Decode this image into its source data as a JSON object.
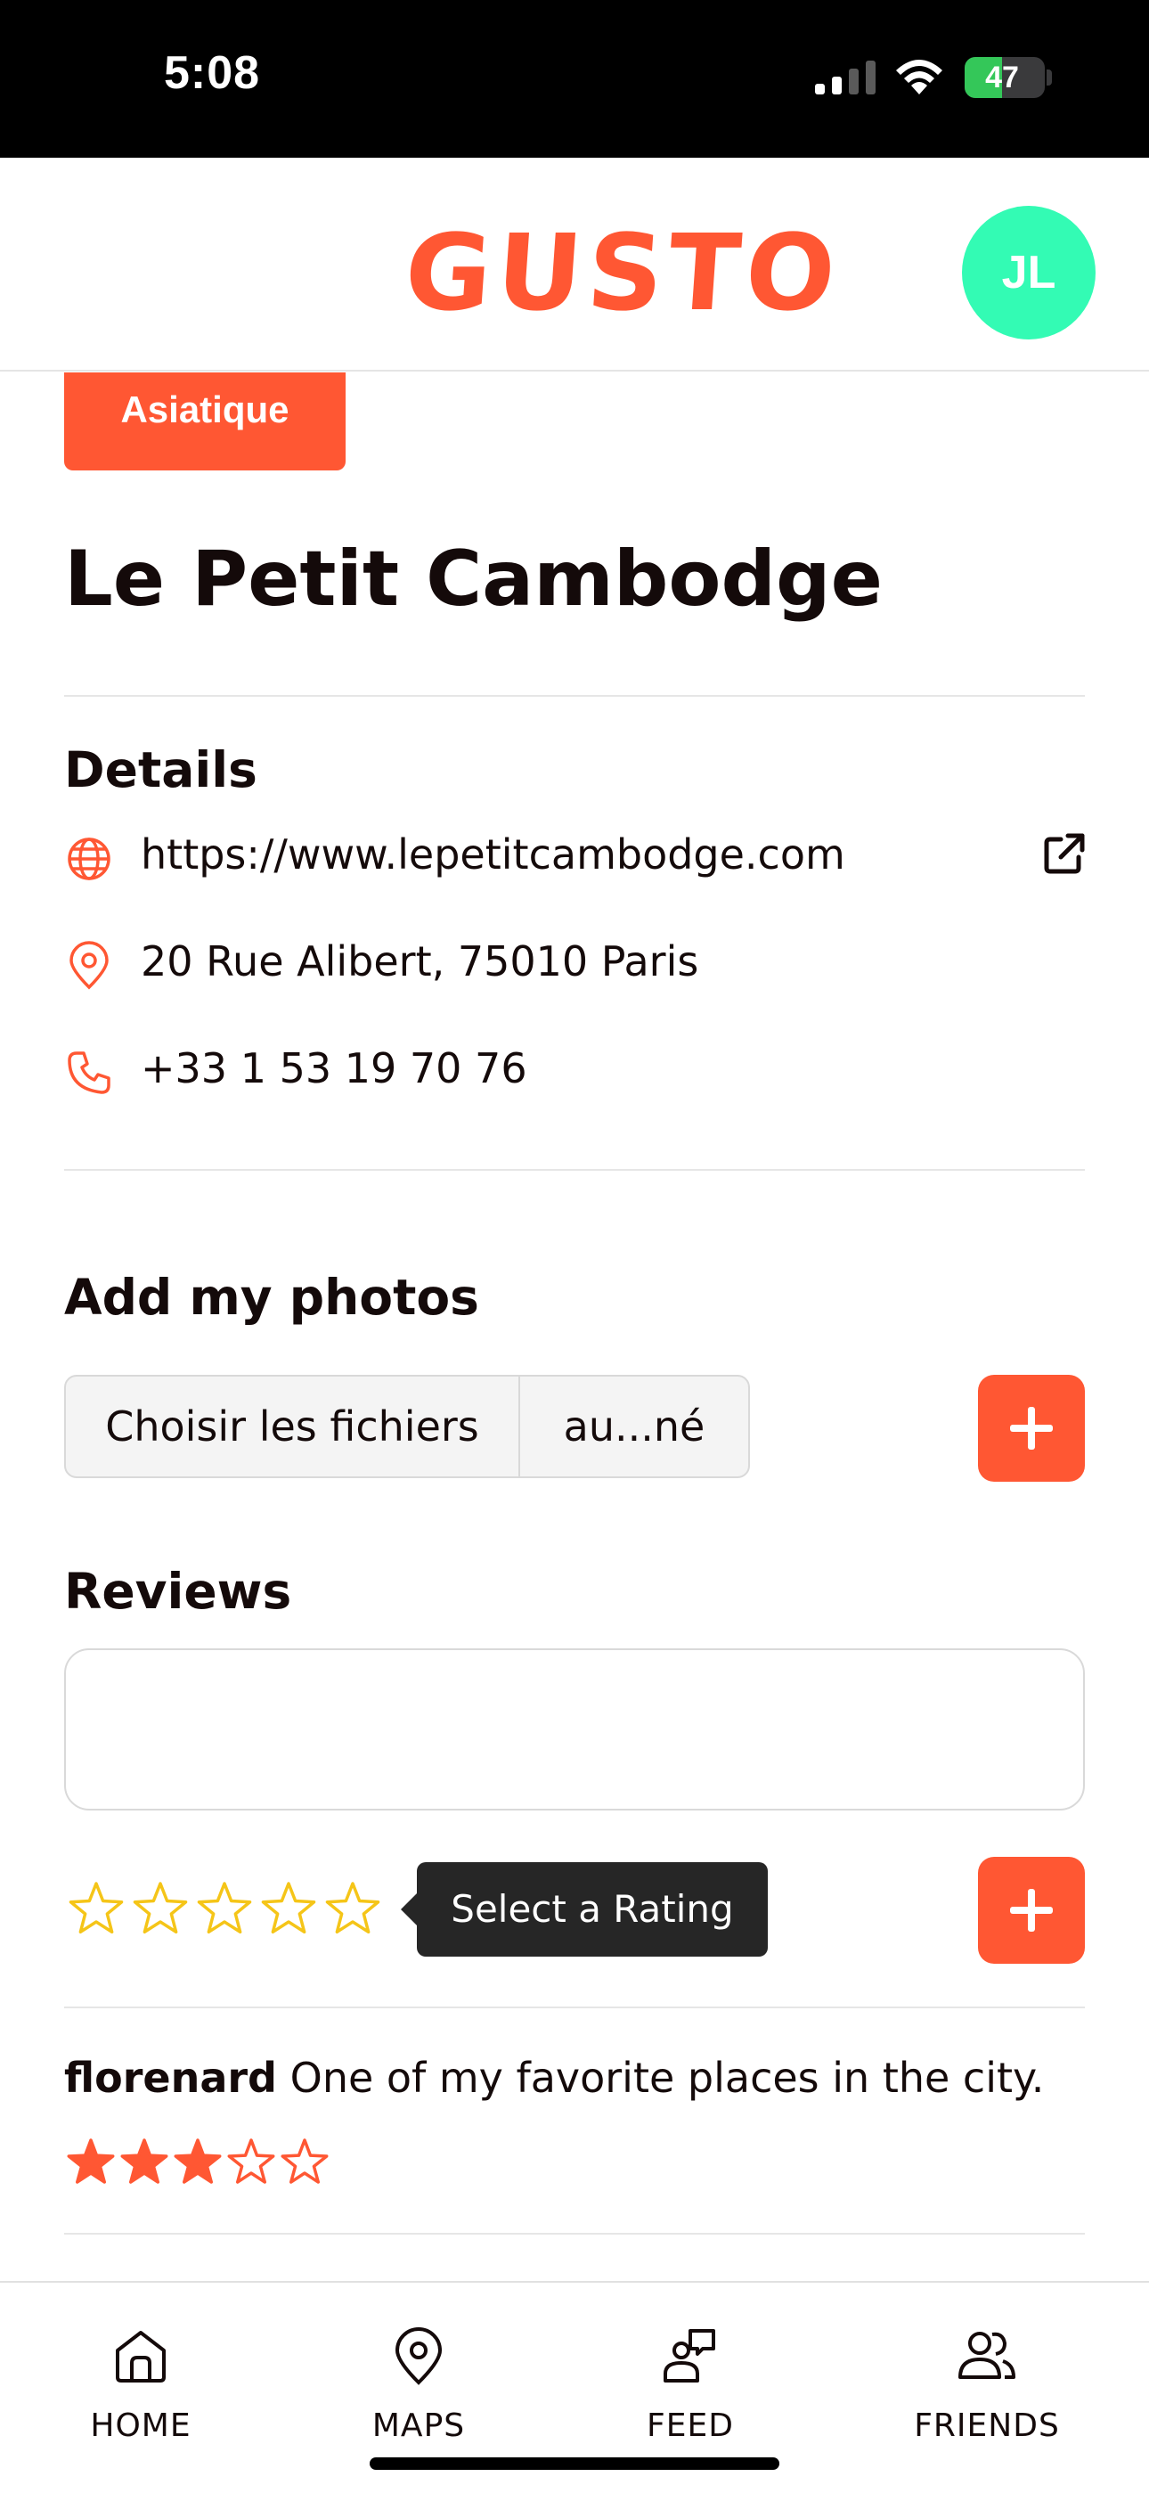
{
  "status_bar": {
    "time": "5:08",
    "battery": "47",
    "battery_level": 0.47
  },
  "header": {
    "logo": "GUSTO",
    "avatar_initials": "JL"
  },
  "restaurant": {
    "category": "Asiatique",
    "name": "Le Petit Cambodge"
  },
  "details": {
    "title": "Details",
    "website": "https://www.lepetitcambodge.com",
    "address": "20 Rue Alibert, 75010 Paris",
    "phone": "+33 1 53 19 70 76"
  },
  "photos": {
    "title": "Add my photos",
    "file_button": "Choisir les fichiers",
    "file_name": "au...né"
  },
  "reviews": {
    "title": "Reviews",
    "input_value": "",
    "rating_tooltip": "Select a Rating",
    "rating_value": 0,
    "rating_max": 5,
    "items": [
      {
        "user": "florenard",
        "text": "One of my favorite places in the city.",
        "rating": 3
      }
    ]
  },
  "nav": {
    "items": [
      {
        "label": "HOME",
        "icon": "home-icon"
      },
      {
        "label": "MAPS",
        "icon": "map-pin-icon"
      },
      {
        "label": "FEED",
        "icon": "chat-bubbles-icon"
      },
      {
        "label": "FRIENDS",
        "icon": "users-icon"
      }
    ]
  },
  "colors": {
    "accent": "#ff5733",
    "avatar": "#33fbb4",
    "star_outline": "#f5c518",
    "text": "#140a0a"
  }
}
